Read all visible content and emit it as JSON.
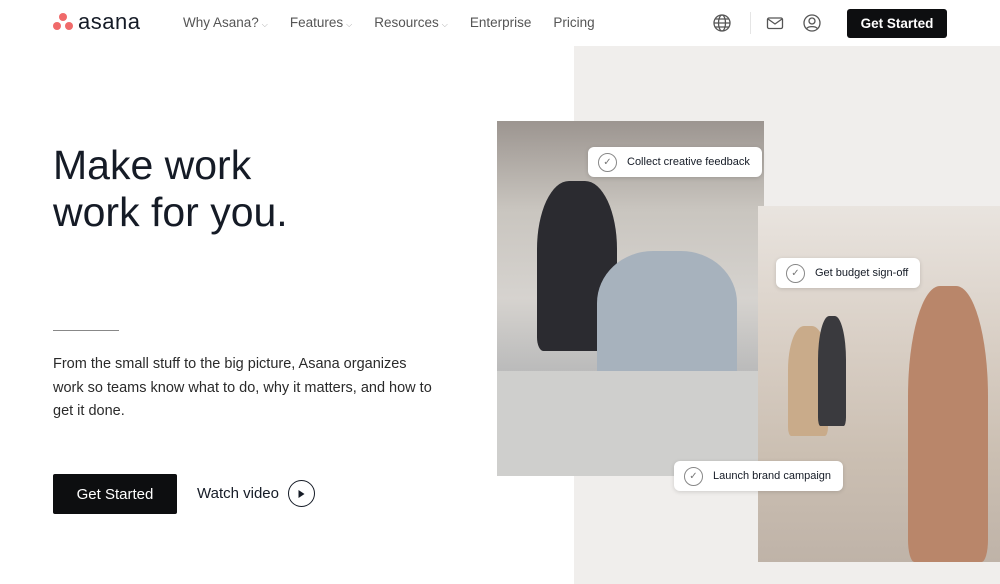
{
  "nav": {
    "brand": "asana",
    "items": [
      {
        "label": "Why Asana?",
        "dropdown": true
      },
      {
        "label": "Features",
        "dropdown": true
      },
      {
        "label": "Resources",
        "dropdown": true
      },
      {
        "label": "Enterprise",
        "dropdown": false
      },
      {
        "label": "Pricing",
        "dropdown": false
      }
    ],
    "cta": "Get Started",
    "icons": [
      "globe-icon",
      "mail-icon",
      "user-icon"
    ]
  },
  "hero": {
    "title_line1": "Make work",
    "title_line2": "work for you.",
    "description": "From the small stuff to the big picture, Asana organizes work so teams know what to do, why it matters, and how to get it done.",
    "cta": "Get Started",
    "video": "Watch video"
  },
  "cards": [
    "Collect creative feedback",
    "Get budget sign-off",
    "Launch brand campaign"
  ],
  "colors": {
    "brand": "#f06a6a",
    "dark": "#0d0e10",
    "panel": "#f0eeec"
  }
}
